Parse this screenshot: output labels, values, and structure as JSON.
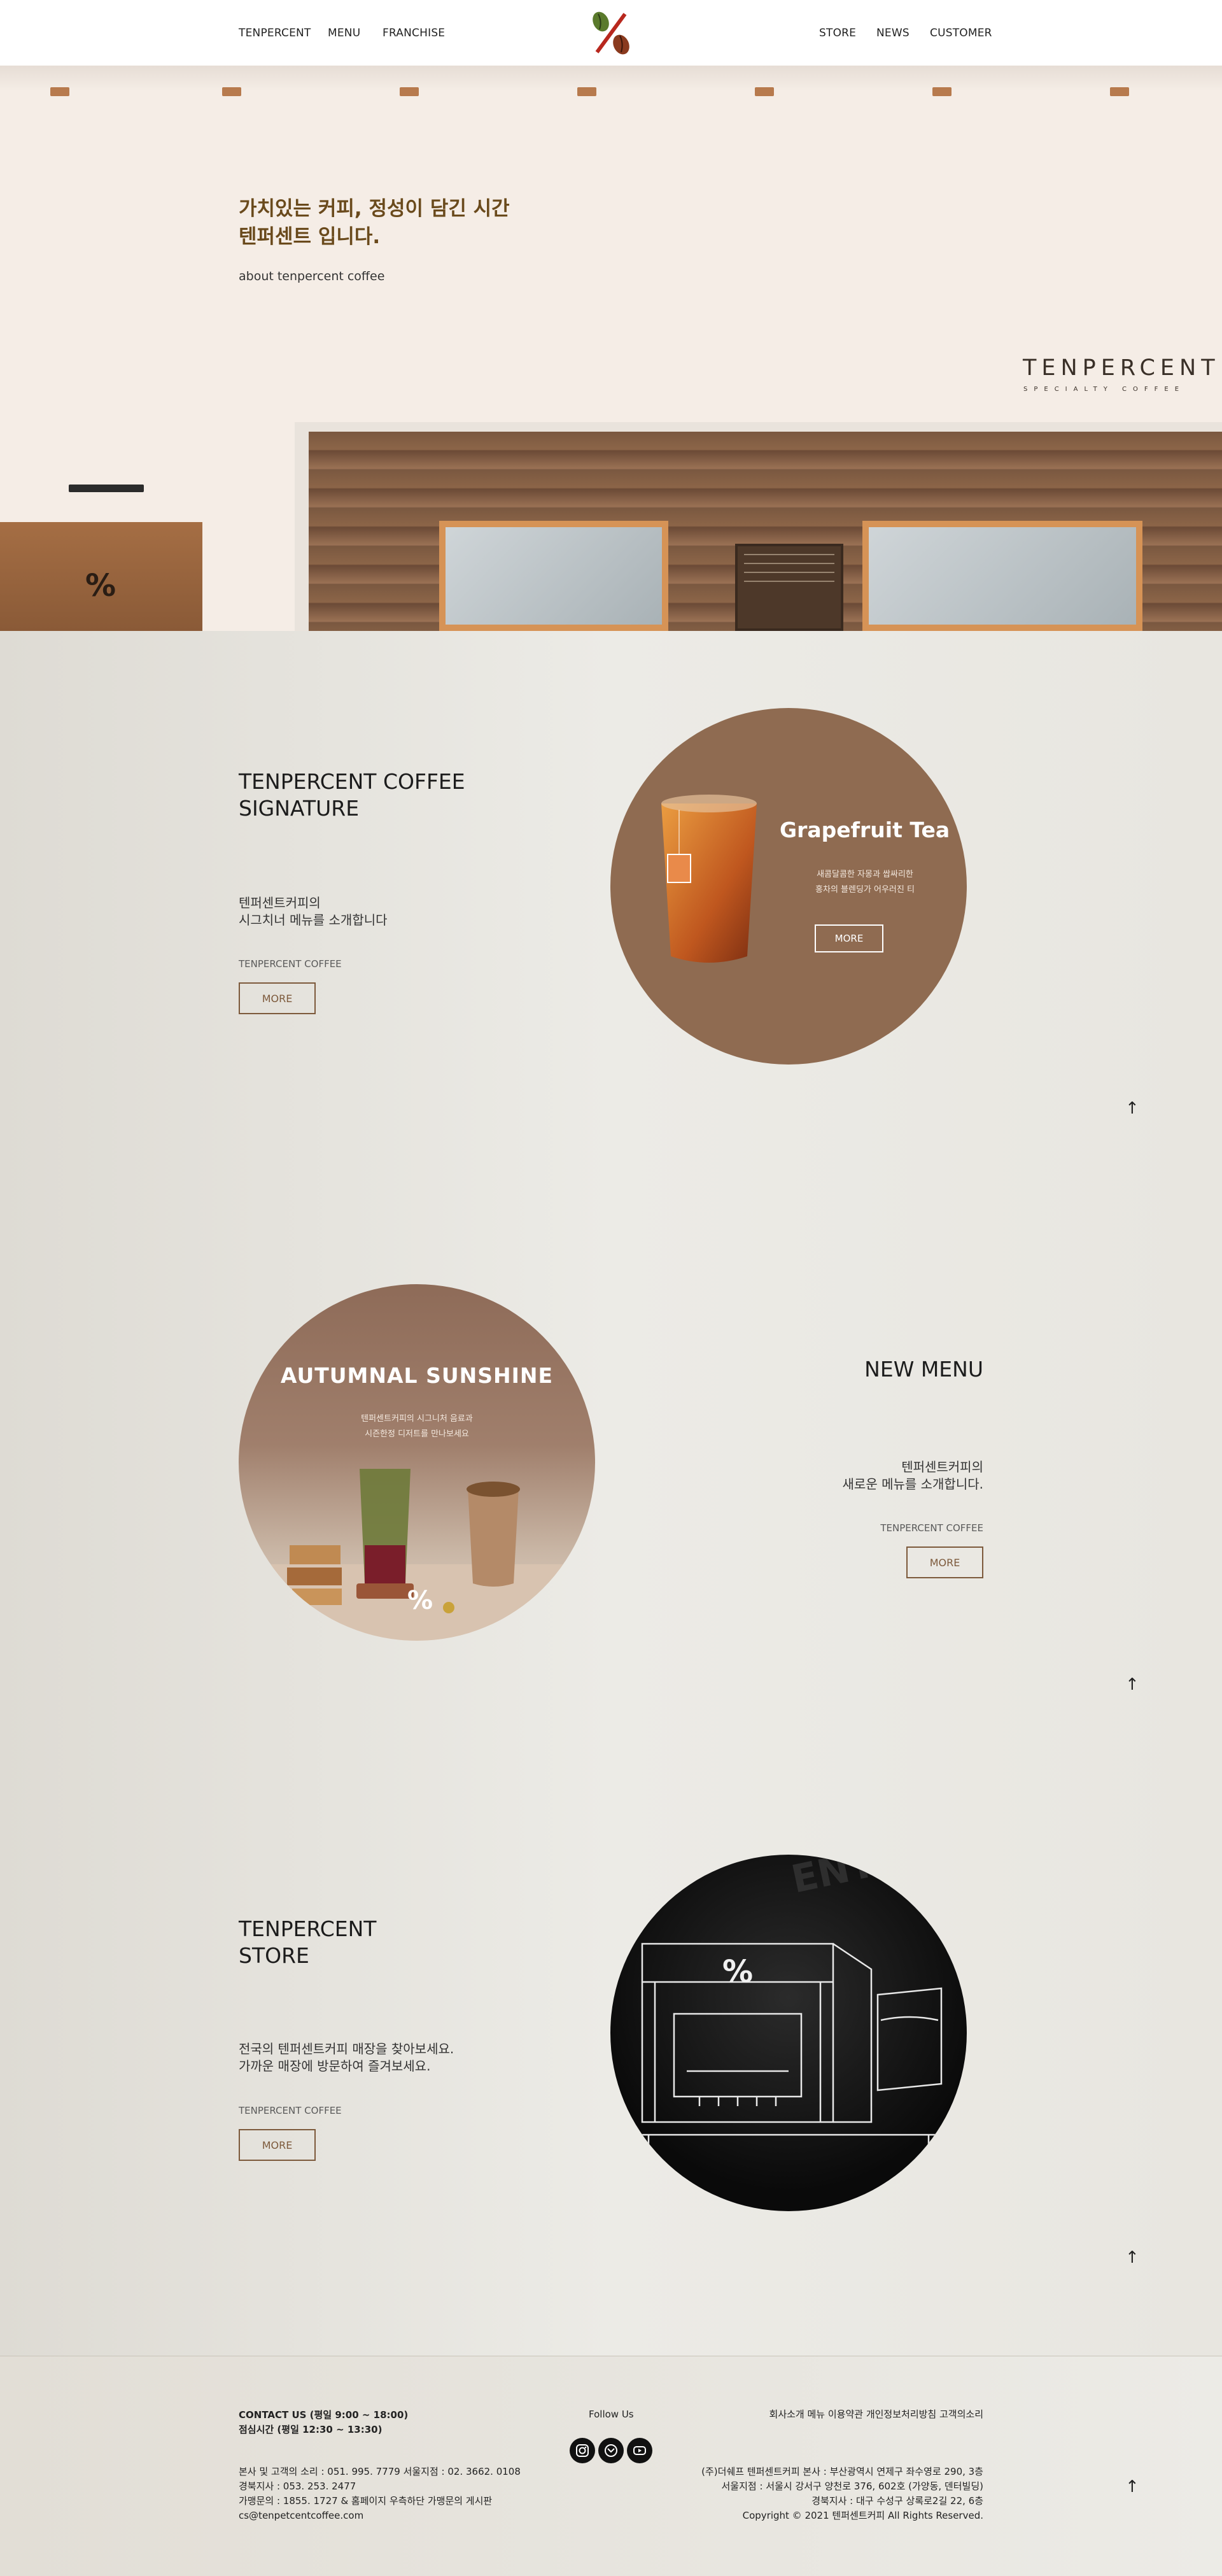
{
  "header": {
    "nav_left": [
      "TENPERCENT",
      "MENU",
      "FRANCHISE"
    ],
    "nav_right": [
      "STORE",
      "NEWS",
      "CUSTOMER"
    ],
    "logo": "%"
  },
  "hero": {
    "headline_line1": "가치있는 커피, 정성이 담긴 시간",
    "headline_line2": "텐퍼센트 입니다.",
    "sub": "about tenpercent coffee",
    "sign": "TENPERCENT",
    "sign_sub": "SPECIALTY COFFEE"
  },
  "signature": {
    "title_line1": "TENPERCENT COFFEE",
    "title_line2": "SIGNATURE",
    "desc_line1": "텐퍼센트커피의",
    "desc_line2": "시그치너 메뉴를 소개합니다",
    "label": "TENPERCENT COFFEE",
    "more": "MORE",
    "circle_title": "Grapefruit Tea",
    "circle_text_line1": "새콤달콤한 자몽과 쌉싸리한",
    "circle_text_line2": "홍차의 블렌딩가 어우러진 티",
    "circle_more": "MORE"
  },
  "new_menu": {
    "title": "NEW MENU",
    "desc_line1": "텐퍼센트커피의",
    "desc_line2": "새로운 메뉴를 소개합니다.",
    "label": "TENPERCENT COFFEE",
    "more": "MORE",
    "circle_title": "AUTUMNAL SUNSHINE",
    "circle_text_line1": "텐퍼센트커피의 시그니처 음료과",
    "circle_text_line2": "시즌한정 디저트를 만나보세요"
  },
  "store": {
    "title_line1": "TENPERCENT",
    "title_line2": "STORE",
    "desc_line1": "전국의 텐퍼센트커피 매장을 찾아보세요.",
    "desc_line2": "가까운 매장에 방문하여 즐겨보세요.",
    "label": "TENPERCENT COFFEE",
    "more": "MORE"
  },
  "footer": {
    "contact_line1": "CONTACT US (평일 9:00 ~ 18:00)",
    "contact_line2": "점심시간 (평일 12:30 ~ 13:30)",
    "info_line1": "본사 및 고객의 소리 : 051. 995. 7779 서울지점 : 02. 3662. 0108",
    "info_line2": "경북지사 : 053. 253. 2477",
    "info_line3": "가맹문의 : 1855. 1727 & 홈페이지 우측하단 가맹문의 게시판",
    "info_line4": "cs@tenpetcentcoffee.com",
    "follow": "Follow Us",
    "links": "회사소개  메뉴  이용약관  개인정보처리방침  고객의소리",
    "addr_line1": "(주)더쉐프 텐퍼센트커피 본사 : 부산광역시 연제구 좌수영로 290, 3층",
    "addr_line2": "서울지점 : 서울시 강서구 양천로 376, 602호 (가양동, 덴터빌딩)",
    "addr_line3": "경북지사 : 대구 수성구 상록로2길 22, 6층",
    "copyright": "Copyright © 2021 텐퍼센트커피 All Rights Reserved."
  },
  "up_arrow": "↑",
  "colors": {
    "accent": "#7d5a3c",
    "headline": "#6a4a1c",
    "circle_brown": "#8f6b51"
  }
}
